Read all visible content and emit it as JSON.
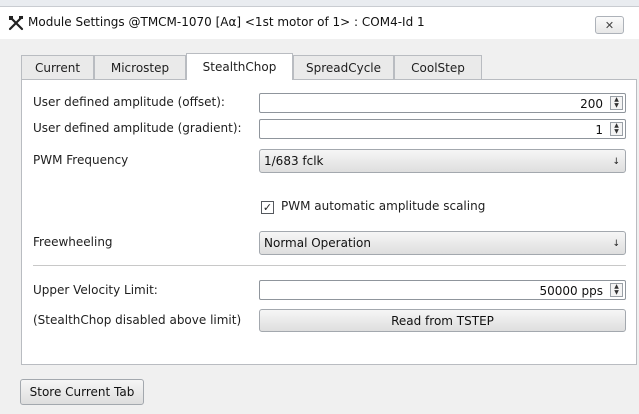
{
  "window": {
    "title": "Module Settings @TMCM-1070 [Aα] <1st motor of 1> : COM4-Id 1",
    "close_glyph": "✕",
    "app_icon": "wrench-screwdriver-icon"
  },
  "tabs": [
    {
      "label": "Current",
      "active": false
    },
    {
      "label": "Microstep",
      "active": false
    },
    {
      "label": "StealthChop",
      "active": true
    },
    {
      "label": "SpreadCycle",
      "active": false
    },
    {
      "label": "CoolStep",
      "active": false
    }
  ],
  "fields": {
    "amp_offset": {
      "label": "User defined amplitude (offset):",
      "value": "200"
    },
    "amp_gradient": {
      "label": "User defined amplitude (gradient):",
      "value": "1"
    },
    "pwm_freq": {
      "label": "PWM Frequency",
      "value": "1/683 fclk"
    },
    "pwm_autoscale": {
      "label": "PWM automatic amplitude scaling",
      "checked": true
    },
    "freewheeling": {
      "label": "Freewheeling",
      "value": "Normal Operation"
    },
    "upper_velocity": {
      "label": "Upper Velocity Limit:",
      "value": "50000 pps"
    },
    "tstep_note": {
      "label": "(StealthChop disabled above limit)"
    }
  },
  "buttons": {
    "read_tstep": "Read from TSTEP",
    "store_tab": "Store Current Tab"
  },
  "glyphs": {
    "spin_up": "▲",
    "spin_down": "▼",
    "combo_arrow": "↓",
    "check": "✓"
  }
}
